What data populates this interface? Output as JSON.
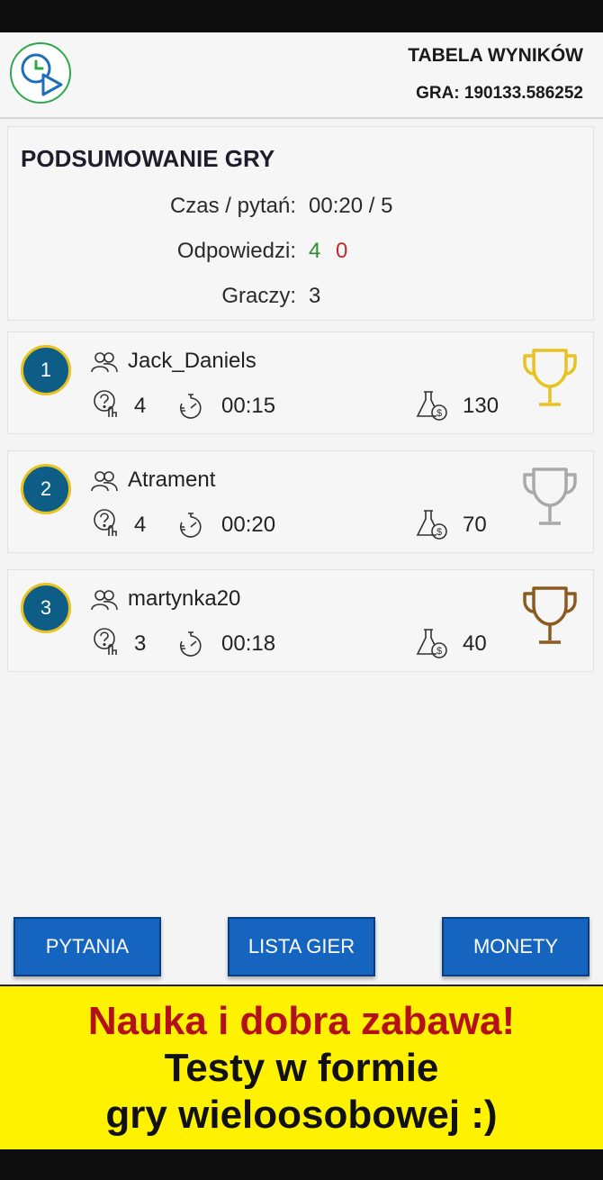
{
  "header": {
    "title": "TABELA WYNIKÓW",
    "game_id": "GRA: 190133.586252",
    "logo_icon": "clock-play-logo-icon"
  },
  "summary": {
    "title": "PODSUMOWANIE GRY",
    "time_label": "Czas / pytań:",
    "time_value": "00:20 / 5",
    "answers_label": "Odpowiedzi:",
    "answers_correct": "4",
    "answers_wrong": "0",
    "players_label": "Graczy:",
    "players_value": "3"
  },
  "players": [
    {
      "rank": "1",
      "name": "Jack_Daniels",
      "answers": "4",
      "time": "00:15",
      "coins": "130",
      "trophy": "gold",
      "trophy_color": "#e8c21f"
    },
    {
      "rank": "2",
      "name": "Atrament",
      "answers": "4",
      "time": "00:20",
      "coins": "70",
      "trophy": "silver",
      "trophy_color": "#a9a9a9"
    },
    {
      "rank": "3",
      "name": "martynka20",
      "answers": "3",
      "time": "00:18",
      "coins": "40",
      "trophy": "bronze",
      "trophy_color": "#8c5a1e"
    }
  ],
  "buttons": {
    "questions": "PYTANIA",
    "games_list": "LISTA GIER",
    "coins": "MONETY"
  },
  "banner": {
    "line1": "Nauka i dobra zabawa!",
    "line2": "Testy w formie",
    "line3": "gry wieloosobowej :)"
  },
  "colors": {
    "rank_fill": "#0d5d86",
    "rank_border": "#e8c21f",
    "button_blue": "#1565c0",
    "banner_yellow": "#fff200",
    "banner_red": "#b3101a",
    "correct_green": "#2f8a2f",
    "wrong_red": "#c62828"
  }
}
